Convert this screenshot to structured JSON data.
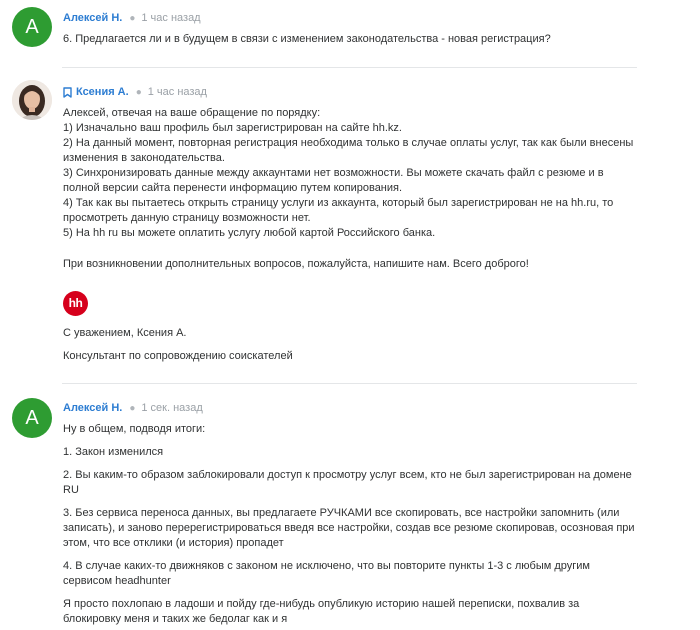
{
  "comments": [
    {
      "author": "Алексей Н.",
      "avatar_letter": "А",
      "time": "1 час назад",
      "text": "6. Предлагается ли и в будущем в связи с изменением законодательства - новая регистрация?"
    },
    {
      "author": "Ксения А.",
      "time": "1 час назад",
      "lines": [
        "Алексей, отвечая на ваше обращение по порядку:",
        "1) Изначально ваш профиль был зарегистрирован на сайте hh.kz.",
        "2) На данный момент, повторная регистрация необходима только в случае оплаты услуг, так как были внесены изменения в законодательства.",
        "3) Синхронизировать данные между аккаунтами нет возможности. Вы можете скачать файл с резюме и в полной версии сайта перенести информацию путем копирования.",
        "4) Так как вы пытаетесь открыть страницу услуги из аккаунта, который был зарегистрирован не на hh.ru, то просмотреть данную страницу возможности нет.",
        "5) На hh ru вы можете оплатить услугу любой картой Российского банка."
      ],
      "closing": "При возникновении дополнительных вопросов, пожалуйста, напишите нам. Всего доброго!",
      "logo_text": "hh",
      "signature": "С уважением, Ксения А.",
      "role": "Консультант по сопровождению соискателей"
    },
    {
      "author": "Алексей Н.",
      "avatar_letter": "А",
      "time": "1 сек. назад",
      "paragraphs": [
        "Ну в общем, подводя итоги:",
        "1. Закон изменился",
        "2. Вы каким-то образом заблокировали доступ к просмотру услуг всем, кто не был зарегистрирован на домене RU",
        "3. Без сервиса переноса данных, вы предлагаете РУЧКАМИ все скопировать, все настройки запомнить (или записать), и заново перерегистрироваться введя все настройки, создав все резюме скопировав, осозновая при этом, что все отклики (и история) пропадет",
        "4. В случае каких-то движняков с законом не исключено, что вы повторите пункты 1-3 с любым другим сервисом headhunter",
        "Я просто похлопаю в ладоши и пойду где-нибудь опубликую историю нашей переписки, похвалив за блокировку меня и таких же бедолаг как и я"
      ]
    }
  ],
  "colors": {
    "author": "#2d7dd2",
    "avatar": "#2e9c32",
    "logo": "#d6001c"
  }
}
